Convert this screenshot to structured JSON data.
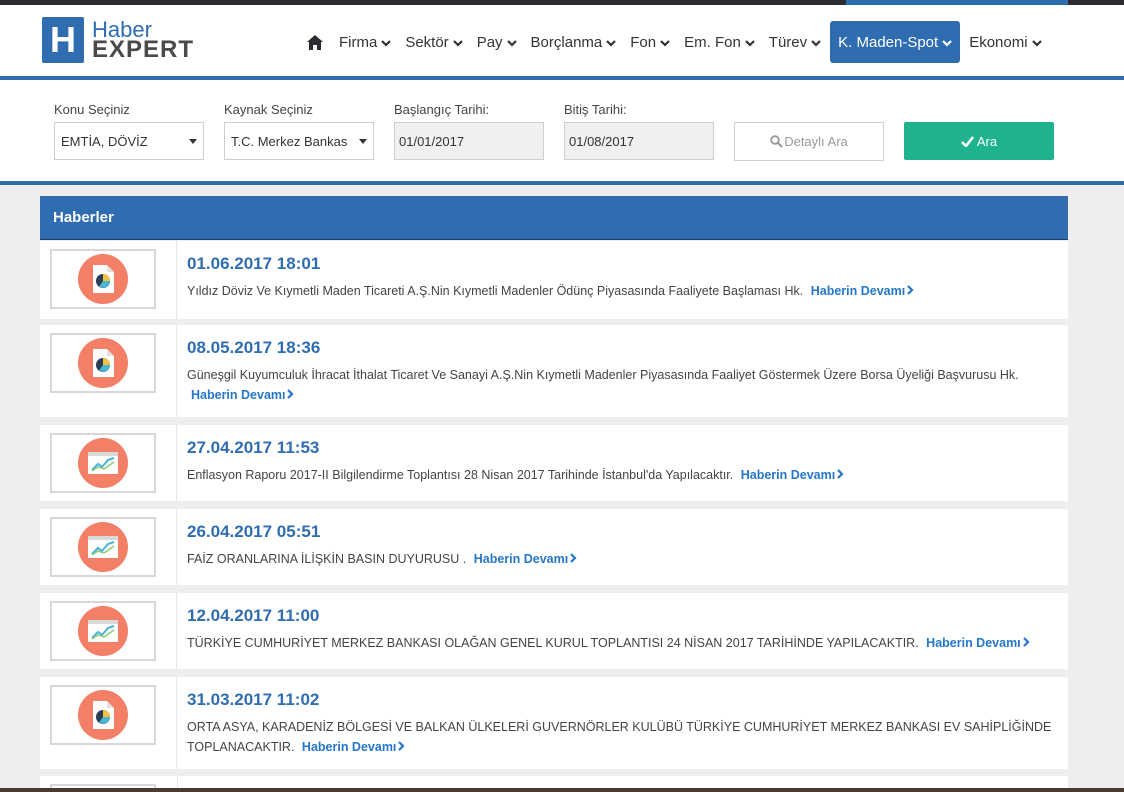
{
  "brand": {
    "logo_letter": "H",
    "name_top": "Haber",
    "name_bottom": "EXPERT",
    "color_primary": "#2f6db0",
    "color_accent": "#1fb28f",
    "color_thumb": "#f37f66"
  },
  "nav": {
    "home_icon": "home-icon",
    "items": [
      {
        "label": "Firma"
      },
      {
        "label": "Sektör"
      },
      {
        "label": "Pay"
      },
      {
        "label": "Borçlanma"
      },
      {
        "label": "Fon"
      },
      {
        "label": "Em. Fon"
      },
      {
        "label": "Türev"
      },
      {
        "label": "K. Maden-Spot",
        "active": true
      },
      {
        "label": "Ekonomi"
      }
    ]
  },
  "filter": {
    "topic_label": "Konu Seçiniz",
    "topic_value": "EMTİA, DÖVİZ",
    "source_label": "Kaynak Seçiniz",
    "source_value": "T.C. Merkez Bankas",
    "start_label": "Başlangıç Tarihi:",
    "start_value": "01/01/2017",
    "end_label": "Bitiş Tarihi:",
    "end_value": "01/08/2017",
    "detail_button": "Detaylı Ara",
    "search_button": "Ara"
  },
  "news": {
    "header": "Haberler",
    "more_label": "Haberin Devamı",
    "items": [
      {
        "date": "01.06.2017 18:01",
        "title": "Yıldız Döviz Ve Kıymetli Maden Ticareti A.Ş.Nin Kıymetli Madenler Ödünç Piyasasında Faaliyete Başlaması Hk.",
        "icon": "pie-document-icon"
      },
      {
        "date": "08.05.2017 18:36",
        "title": "Güneşgil Kuyumculuk İhracat İthalat Ticaret Ve Sanayi A.Ş.Nin Kıymetli Madenler Piyasasında Faaliyet Göstermek Üzere Borsa Üyeliği Başvurusu Hk.",
        "icon": "pie-document-icon"
      },
      {
        "date": "27.04.2017 11:53",
        "title": "Enflasyon Raporu 2017-II Bilgilendirme Toplantısı 28 Nisan 2017 Tarihinde İstanbul'da Yapılacaktır.",
        "icon": "line-chart-icon"
      },
      {
        "date": "26.04.2017 05:51",
        "title": "FAİZ ORANLARINA İLİŞKİN BASIN DUYURUSU .",
        "icon": "line-chart-icon"
      },
      {
        "date": "12.04.2017 11:00",
        "title": "TÜRKİYE CUMHURİYET MERKEZ BANKASI OLAĞAN GENEL KURUL TOPLANTISI 24 NİSAN 2017 TARİHİNDE YAPILACAKTIR.",
        "icon": "line-chart-icon"
      },
      {
        "date": "31.03.2017 11:02",
        "title": "ORTA ASYA, KARADENİZ BÖLGESİ VE BALKAN ÜLKELERİ GUVERNÖRLER KULÜBÜ TÜRKİYE CUMHURİYET MERKEZ BANKASI EV SAHİPLİĞİNDE TOPLANACAKTIR.",
        "icon": "pie-document-icon"
      }
    ]
  }
}
